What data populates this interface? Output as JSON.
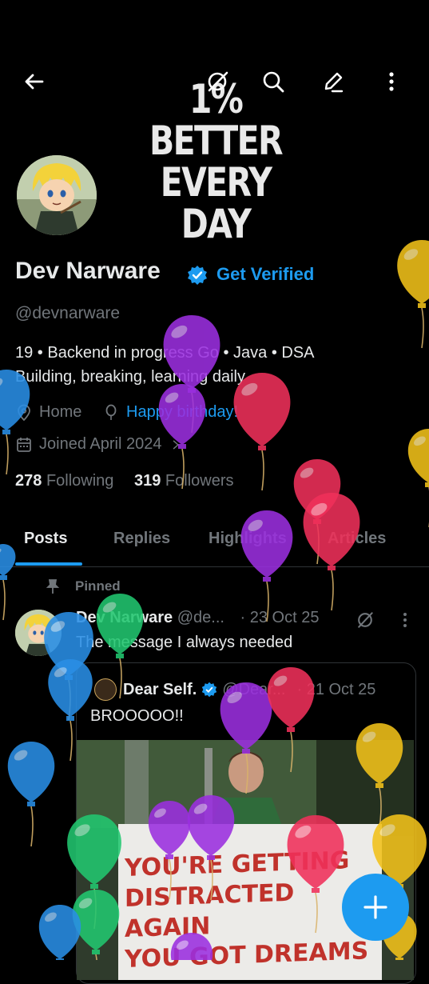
{
  "banner": {
    "line1": "1% BETTER",
    "line2": "EVERY DAY"
  },
  "header": {
    "back_icon": "arrow-left-icon",
    "right_icons": [
      "grok-icon",
      "search-icon",
      "edit-icon",
      "more-icon"
    ]
  },
  "profile": {
    "name": "Dev Narware",
    "get_verified": "Get Verified",
    "handle": "@devnarware",
    "bio_line1": "19 • Backend in progress  Go • Java • DSA",
    "bio_line2": "Building, breaking, learning daily",
    "location": "Home",
    "birthday": "Happy birthday!",
    "joined": "Joined April 2024",
    "following_count": "278",
    "following_label": "Following",
    "followers_count": "319",
    "followers_label": "Followers"
  },
  "tabs": [
    {
      "label": "Posts",
      "active": true
    },
    {
      "label": "Replies",
      "active": false
    },
    {
      "label": "Highlights",
      "active": false
    },
    {
      "label": "Articles",
      "active": false
    }
  ],
  "post": {
    "pinned_label": "Pinned",
    "author": "Dev Narware",
    "handle": "@de...",
    "date": "· 23 Oct 25",
    "text": "The message I always needed",
    "quote": {
      "author": "Dear Self.",
      "handle": "@Dear...",
      "date": "· 21 Oct 25",
      "text": "BROOOOO!!",
      "sign_lines": [
        "YOU'RE GETTING",
        "DISTRACTED AGAIN",
        "YOU GOT DREAMS"
      ]
    }
  },
  "colors": {
    "accent": "#1d9bf0",
    "background": "#000000",
    "muted": "#71767b",
    "balloon_purple": "#9b2fe0",
    "balloon_red": "#f0305a",
    "balloon_blue": "#2a8fe6",
    "balloon_green": "#22c770",
    "balloon_yellow": "#f2c21a"
  },
  "fab_icon": "plus-icon"
}
